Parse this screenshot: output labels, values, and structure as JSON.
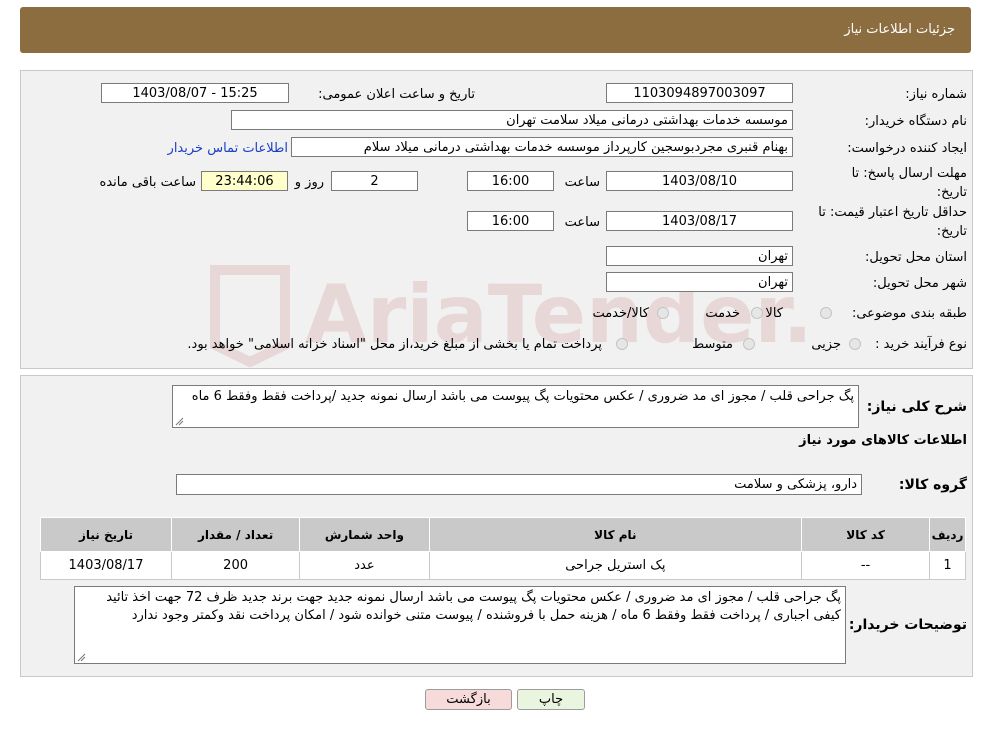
{
  "header": {
    "title": "جزئیات اطلاعات نیاز"
  },
  "watermark": {
    "text": "AriaTender.neT"
  },
  "form": {
    "need_number": {
      "label": "شماره نیاز:",
      "value": "1103094897003097"
    },
    "announce_datetime": {
      "label": "تاریخ و ساعت اعلان عمومی:",
      "value": "1403/08/07 - 15:25"
    },
    "buyer_org": {
      "label": "نام دستگاه خریدار:",
      "value": "موسسه خدمات بهداشتی درمانی میلاد سلامت تهران"
    },
    "requester": {
      "label": "ایجاد کننده درخواست:",
      "value": "بهنام قنبری مجردبوسجین کارپرداز موسسه خدمات بهداشتی درمانی میلاد سلام",
      "contact_link": "اطلاعات تماس خریدار"
    },
    "reply_deadline": {
      "label_line1": "مهلت ارسال پاسخ: تا",
      "label_line2": "تاریخ:",
      "date": "1403/08/10",
      "time_label": "ساعت",
      "time": "16:00",
      "days": "2",
      "days_label": "روز و",
      "remaining": "23:44:06",
      "remaining_label": "ساعت باقی مانده"
    },
    "price_validity": {
      "label_line1": "حداقل تاریخ اعتبار قیمت: تا",
      "label_line2": "تاریخ:",
      "date": "1403/08/17",
      "time_label": "ساعت",
      "time": "16:00"
    },
    "province": {
      "label": "استان محل تحویل:",
      "value": "تهران"
    },
    "city": {
      "label": "شهر محل تحویل:",
      "value": "تهران"
    },
    "category": {
      "label": "طبقه بندی موضوعی:",
      "options": [
        "کالا",
        "خدمت",
        "کالا/خدمت"
      ]
    },
    "purchase_type": {
      "label": "نوع فرآیند خرید :",
      "options": [
        "جزیی",
        "متوسط"
      ],
      "note": "پرداخت تمام یا بخشی از مبلغ خرید،از محل \"اسناد خزانه اسلامی\" خواهد بود."
    }
  },
  "summary": {
    "label": "شرح کلی نیاز:",
    "text": "پگ جراحی قلب  / مجوز ای مد ضروری / عکس محتویات پگ پیوست می باشد ارسال نمونه جدید /پرداخت فقط وفقط 6 ماه"
  },
  "goods": {
    "section_title": "اطلاعات کالاهای مورد نیاز",
    "group_label": "گروه کالا:",
    "group_value": "دارو، پزشکی و سلامت",
    "table": {
      "columns": [
        "ردیف",
        "کد کالا",
        "نام کالا",
        "واحد شمارش",
        "تعداد / مقدار",
        "تاریخ نیاز"
      ],
      "rows": [
        {
          "row": "1",
          "code": "--",
          "name": "پک استریل جراحی",
          "unit": "عدد",
          "qty": "200",
          "date": "1403/08/17"
        }
      ]
    }
  },
  "buyer_notes": {
    "label": "توضیحات خریدار:",
    "text": "پگ جراحی قلب  / مجوز ای مد ضروری / عکس محتویات پگ پیوست می باشد ارسال نمونه جدید جهت برند جدید ظرف 72 جهت اخذ تائید کیفی اجباری / پرداخت فقط وفقط 6  ماه / هزینه حمل با فروشنده / پیوست  متنی خوانده شود / امکان پرداخت نقد وکمتر وجود ندارد"
  },
  "buttons": {
    "print": "چاپ",
    "back": "بازگشت"
  },
  "colors": {
    "header": "#8c6d3f",
    "link": "#1a3fc8",
    "back_button": "#f7dada",
    "print_button": "#eaf5e0"
  }
}
